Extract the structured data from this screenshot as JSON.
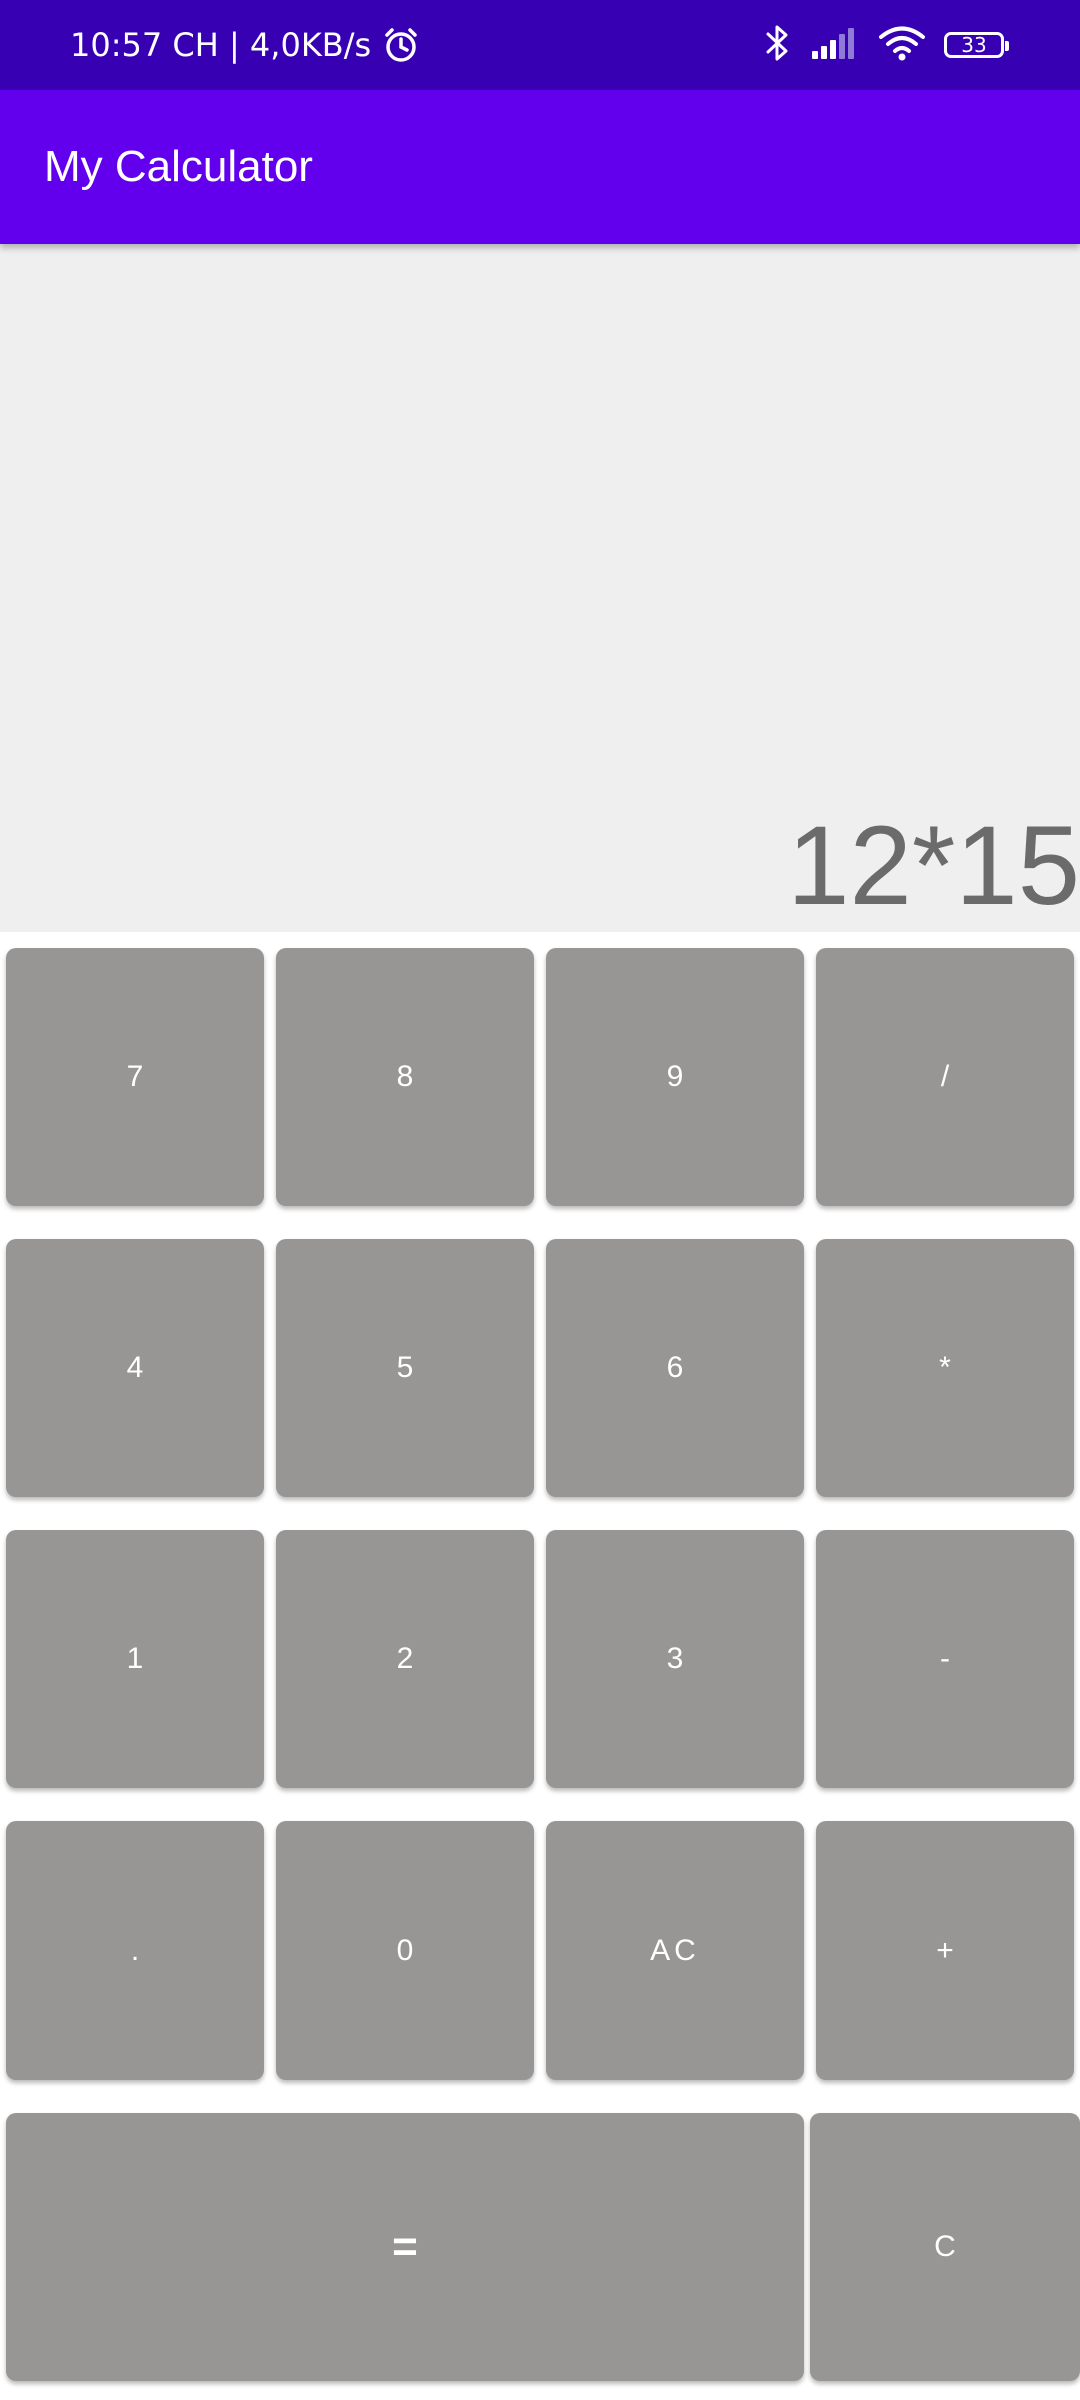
{
  "status_bar": {
    "time": "10:57 CH | 4,0KB/s",
    "battery": "33"
  },
  "app_bar": {
    "title": "My Calculator"
  },
  "display": {
    "expression": "12*15"
  },
  "keys": {
    "k7": "7",
    "k8": "8",
    "k9": "9",
    "divide": "/",
    "k4": "4",
    "k5": "5",
    "k6": "6",
    "multiply": "*",
    "k1": "1",
    "k2": "2",
    "k3": "3",
    "minus": "-",
    "dot": ".",
    "k0": "0",
    "all_clear": "AC",
    "plus": "+",
    "equals": "=",
    "clear": "C"
  },
  "colors": {
    "status_bar": "#3700b3",
    "app_bar": "#6200ee",
    "display_bg": "#efefef",
    "key_bg": "#979695",
    "expression_text": "#6b6b6b"
  }
}
